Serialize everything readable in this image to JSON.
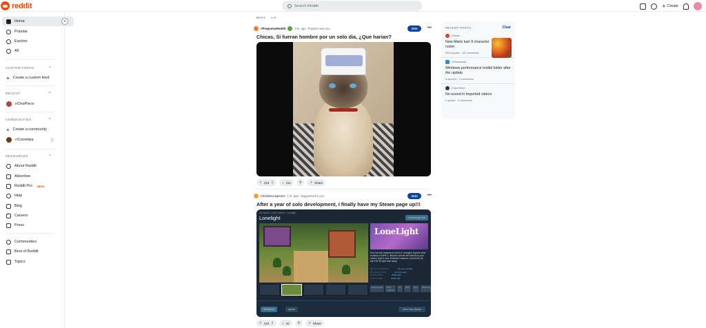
{
  "header": {
    "logo_text": "reddit",
    "search_placeholder": "Search Reddit",
    "create_label": "Create"
  },
  "sidebar": {
    "main": [
      {
        "label": "Home",
        "icon": "home-icon"
      },
      {
        "label": "Popular",
        "icon": "popular-icon"
      },
      {
        "label": "Explore",
        "icon": "explore-icon"
      },
      {
        "label": "All",
        "icon": "all-icon"
      }
    ],
    "custom_feeds": {
      "title": "CUSTOM FEEDS",
      "create": "Create a custom feed"
    },
    "recent": {
      "title": "RECENT",
      "items": [
        "r/OnePiece"
      ]
    },
    "communities": {
      "title": "COMMUNITIES",
      "create": "Create a community",
      "items": [
        "r/Colombia"
      ]
    },
    "resources": {
      "title": "RESOURCES",
      "items": [
        "About Reddit",
        "Advertise",
        "Reddit Pro",
        "Help",
        "Blog",
        "Careers",
        "Press"
      ],
      "beta": "BETA"
    },
    "bottom": [
      "Communities",
      "Best of Reddit",
      "Topics"
    ]
  },
  "sort": {
    "label": "Best"
  },
  "posts": [
    {
      "subreddit": "r/PreguntasReddit",
      "time": "3 hr. ago",
      "reason": "Popular near you",
      "join": "Join",
      "title": "Chicas, Si fueran hombre por un solo dia, ¿Que harian?",
      "upvotes": "219",
      "comments": "211",
      "share": "Share"
    },
    {
      "subreddit": "r/SoloDevelopment",
      "time": "1 hr. ago",
      "reason": "Suggested for you",
      "join": "Join",
      "title": "After a year of solo development, I finally have my Steam page up!!!",
      "upvotes": "222",
      "comments": "42",
      "share": "Share",
      "steam": {
        "crumbs": "All Games > Indie Games > Lonelight",
        "game_title": "Lonelight",
        "hub": "Community Hub",
        "capsule_logo": "LoneLight",
        "description": "Dive into the mysterious world of Lonelight! Explore what remains of Earth 2, discover secrets left behind by your creator, fight a vast of twisted creatures, and above all, don't let the light fade away.",
        "meta_labels": [
          "RECENT REVIEWS:",
          "RELEASE DATE:",
          "DEVELOPER:",
          "PUBLISHER:"
        ],
        "meta_values": [
          "No user reviews",
          "Coming soon",
          "STELLAR",
          "STELLAR"
        ],
        "tags": [
          "Metroidvania",
          "Pixel Graphics",
          "2D",
          "Indie",
          "Cute",
          "Platformer"
        ],
        "wishlist": "Wishlisted",
        "ignore": "Ignore",
        "queue": "View Your Queue"
      }
    }
  ],
  "recent_posts": {
    "title": "RECENT POSTS",
    "clear": "Clear",
    "items": [
      {
        "subreddit": "r/Mario",
        "title": "New Mario kart 9 character roster",
        "stats": "306 upvotes · 111 comments"
      },
      {
        "subreddit": "r/Windows11",
        "title": "Windows performance toolkit folder after the update",
        "stats": "6 upvotes · 3 comments"
      },
      {
        "subreddit": "r/OpenShot",
        "title": "No sound in imported videos",
        "stats": "1 upvote · 3 comments"
      }
    ]
  },
  "colors": {
    "brand": "#ff4500",
    "join": "#0a449b",
    "sidebar_active": "#e5ebee"
  }
}
